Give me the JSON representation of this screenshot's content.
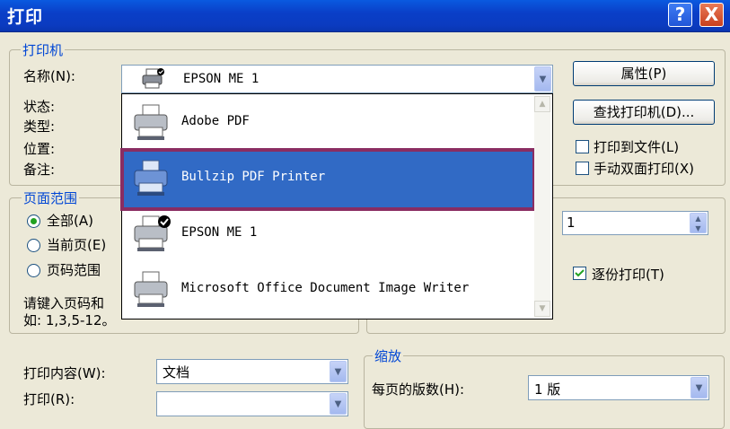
{
  "window": {
    "title": "打印",
    "help": "?",
    "close": "X"
  },
  "printer_group": {
    "label": "打印机",
    "name_label": "名称(N):",
    "status_label": "状态:",
    "type_label": "类型:",
    "where_label": "位置:",
    "comment_label": "备注:",
    "selected": "EPSON ME 1",
    "properties_button": "属性(P)",
    "find_button": "查找打印机(D)...",
    "print_to_file": "打印到文件(L)",
    "manual_duplex": "手动双面打印(X)"
  },
  "dropdown_items": [
    {
      "name": "Adobe PDF",
      "icon": "printer-icon"
    },
    {
      "name": "Bullzip PDF Printer",
      "icon": "printer-icon",
      "selected": true
    },
    {
      "name": "EPSON ME 1",
      "icon": "default-printer-icon"
    },
    {
      "name": "Microsoft Office Document Image Writer",
      "icon": "printer-icon"
    }
  ],
  "page_range": {
    "label": "页面范围",
    "all": "全部(A)",
    "current": "当前页(E)",
    "pages": "页码范围",
    "hint": "请键入页码和",
    "example": "如: 1,3,5-12。"
  },
  "copies": {
    "value": "1",
    "collate": "逐份打印(T)"
  },
  "print_what": {
    "label": "打印内容(W):",
    "value": "文档"
  },
  "print": {
    "label": "打印(R):"
  },
  "zoom": {
    "label": "缩放",
    "pages_per_sheet_label": "每页的版数(H):",
    "pages_per_sheet_value": "1 版"
  }
}
